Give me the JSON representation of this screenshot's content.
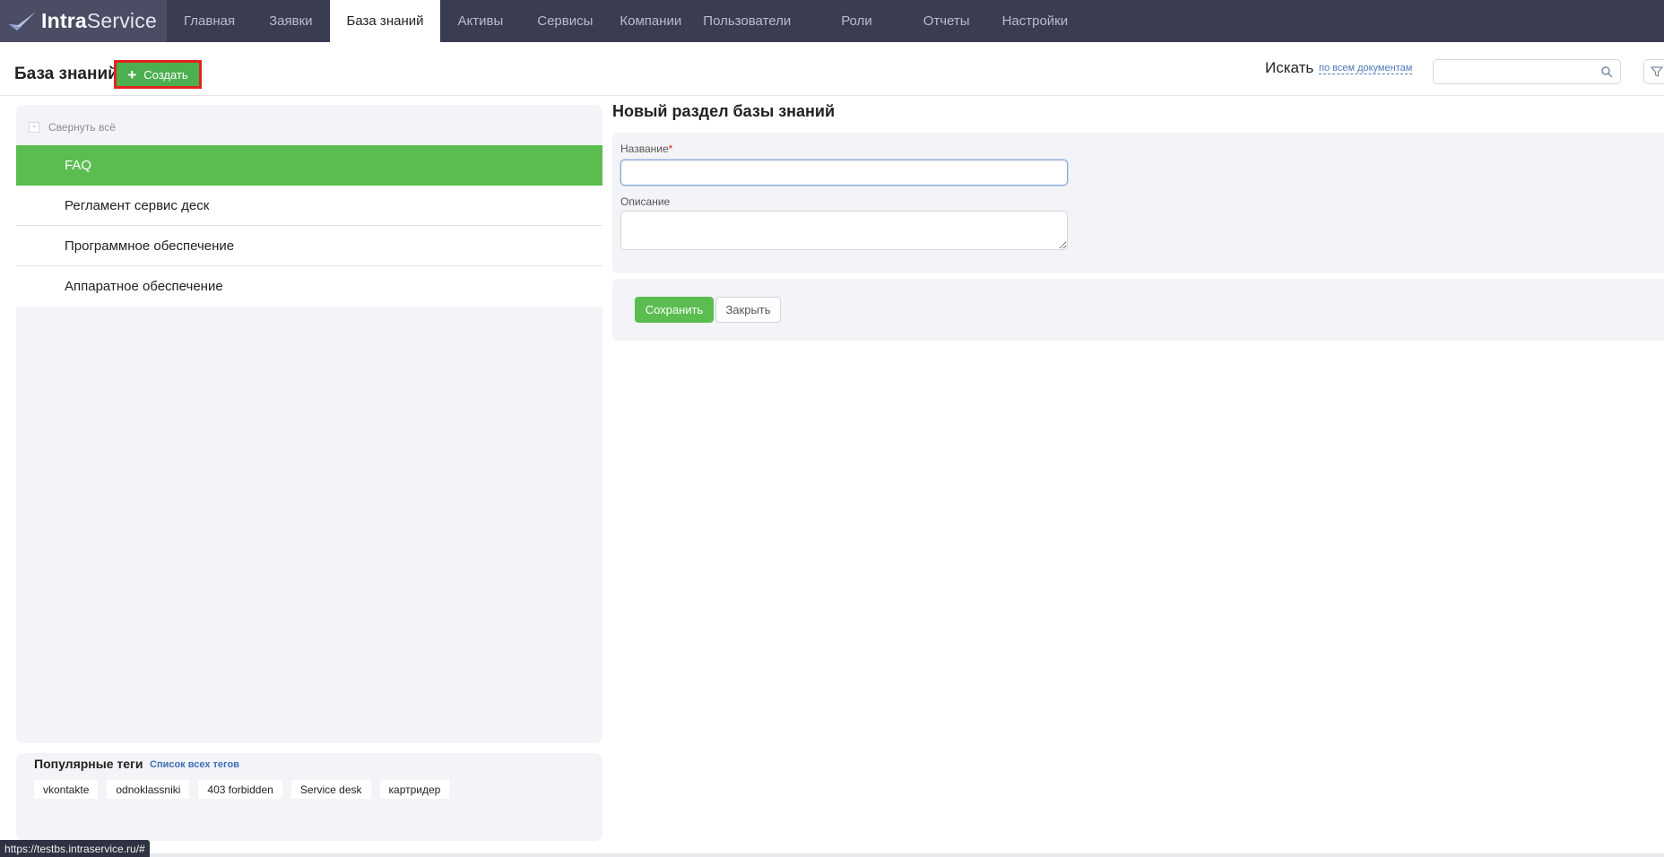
{
  "app": {
    "logo_bold": "Intra",
    "logo_light": "Service"
  },
  "nav": {
    "items": [
      {
        "label": "Главная"
      },
      {
        "label": "Заявки"
      },
      {
        "label": "База знаний"
      },
      {
        "label": "Активы"
      },
      {
        "label": "Сервисы"
      },
      {
        "label": "Компании"
      },
      {
        "label": "Пользователи"
      },
      {
        "label": "Роли"
      },
      {
        "label": "Отчеты"
      },
      {
        "label": "Настройки"
      }
    ],
    "active_index": 2
  },
  "header": {
    "title": "База знаний",
    "create_label": "Создать",
    "search_label": "Искать",
    "search_scope": "по всем документам",
    "search_placeholder": ""
  },
  "tree": {
    "collapse_label": "Свернуть всё",
    "items": [
      {
        "label": "FAQ",
        "active": true
      },
      {
        "label": "Регламент сервис деск"
      },
      {
        "label": "Программное обеспечение"
      },
      {
        "label": "Аппаратное обеспечение"
      }
    ]
  },
  "tags": {
    "title": "Популярные теги",
    "all_link": "Список всех тегов",
    "items": [
      "vkontakte",
      "odnoklassniki",
      "403 forbidden",
      "Service desk",
      "картридер"
    ]
  },
  "form": {
    "title": "Новый раздел базы знаний",
    "name_label": "Название",
    "required_mark": "*",
    "name_value": "",
    "description_label": "Описание",
    "description_value": "",
    "save_label": "Сохранить",
    "close_label": "Закрыть"
  },
  "status_url": "https://testbs.intraservice.ru/#",
  "colors": {
    "nav_bg": "#3a3d52",
    "accent_green": "#5bbd50",
    "highlight_red": "#e0241c",
    "link_blue": "#3d6fb6"
  }
}
